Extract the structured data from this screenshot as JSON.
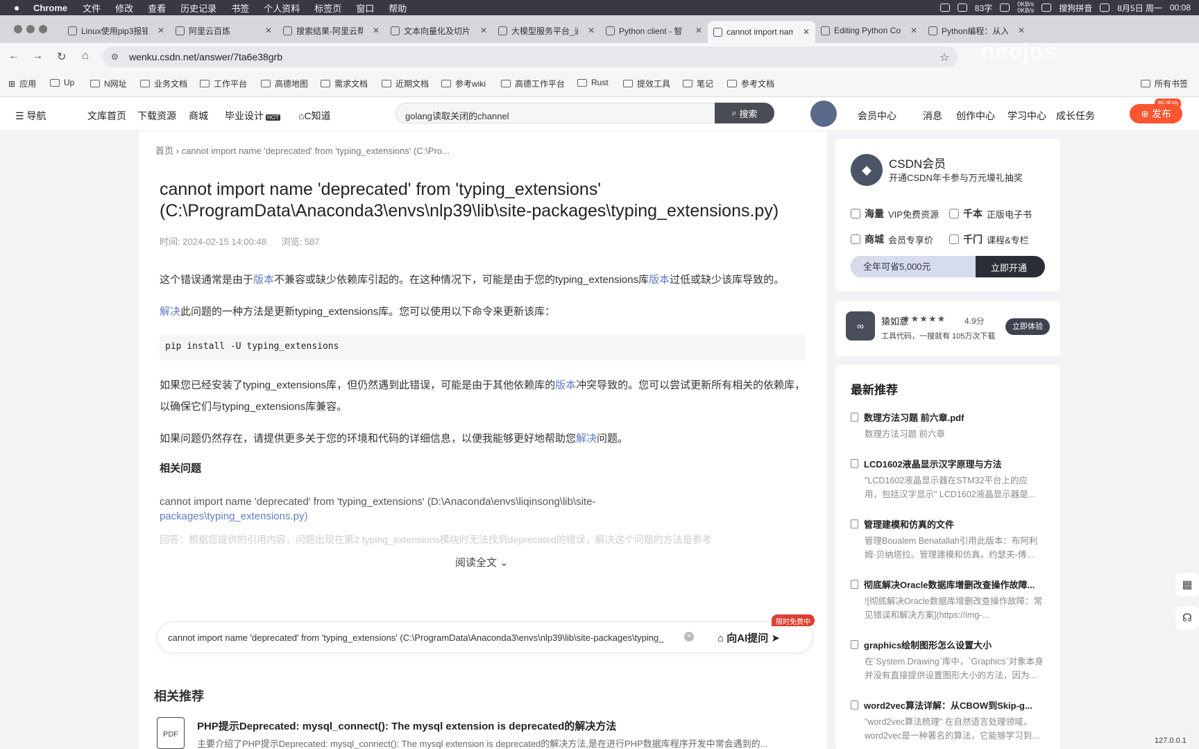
{
  "menubar": {
    "app": "Chrome",
    "items": [
      "文件",
      "修改",
      "查看",
      "历史记录",
      "书签",
      "个人资料",
      "标签页",
      "窗口",
      "帮助"
    ],
    "ime_chars": "83字",
    "net_up": "0KB/s",
    "net_down": "0KB/s",
    "ime": "搜狗拼音",
    "date": "8月5日 周一",
    "time": "00:08"
  },
  "tabs": [
    {
      "title": "Linux使用pip3报错",
      "active": false
    },
    {
      "title": "阿里云百炼",
      "active": false
    },
    {
      "title": "搜索结果-阿里云帮",
      "active": false
    },
    {
      "title": "文本向量化及切片",
      "active": false
    },
    {
      "title": "大模型服务平台_通",
      "active": false
    },
    {
      "title": "Python client - 智",
      "active": false
    },
    {
      "title": "cannot import nam",
      "active": true
    },
    {
      "title": "Editing Python Co",
      "active": false
    },
    {
      "title": "Python编程：从入",
      "active": false
    }
  ],
  "toolbar": {
    "url": "wenku.csdn.net/answer/7ta6e38grb"
  },
  "bookmarks": [
    "应用",
    "Up",
    "N网址",
    "业务文档",
    "工作平台",
    "高德地图",
    "需求文档",
    "近期文档",
    "参考wiki",
    "高德工作平台",
    "Rust",
    "提效工具",
    "笔记",
    "参考文档"
  ],
  "bookmarks_all": "所有书签",
  "site": {
    "nav": "导航",
    "links": [
      "文库首页",
      "下载资源",
      "商城",
      "毕业设计",
      "C知道"
    ],
    "hot_badge": "HOT",
    "search_value": "golang读取关闭的channel",
    "search_button": "搜索",
    "user_links": [
      "会员中心",
      "消息",
      "创作中心",
      "学习中心",
      "成长任务"
    ],
    "new_badge": "新活动",
    "publish": "发布"
  },
  "article": {
    "breadcrumb_home": "首页",
    "breadcrumb_current": "cannot import name 'deprecated' from 'typing_extensions' (C:\\Pro...",
    "title": "cannot import name 'deprecated' from 'typing_extensions' (C:\\ProgramData\\Anaconda3\\envs\\nlp39\\lib\\site-packages\\typing_extensions.py)",
    "time": "时间: 2024-02-15 14:00:48",
    "views": "浏览: 587",
    "p1": [
      "这个错误通常是由于",
      "版本",
      "不兼容或缺少依赖库引起的。在这种情况下，可能是由于您的typing_extensions库",
      "版本",
      "过低或缺少该库导致的。"
    ],
    "p2": [
      "解决",
      "此问题的一种方法是更新typing_extensions库。您可以使用以下命令来更新该库："
    ],
    "code": "pip install -U typing_extensions",
    "p3": [
      "如果您已经安装了typing_extensions库，但仍然遇到此错误，可能是由于其他依赖库的",
      "版本",
      "冲突导致的。您可以尝试更新所有相关的依赖库，以确保它们与typing_extensions库兼容。"
    ],
    "p4": [
      "如果问题仍然存在，请提供更多关于您的环境和代码的详细信息，以便我能够更好地帮助您",
      "解决",
      "问题。"
    ],
    "related_title": "相关问题",
    "related_q": "cannot import name 'deprecated' from 'typing_extensions' (D:\\Anaconda\\envs\\liqinsong\\lib\\site-",
    "related_q2": "packages\\typing_extensions.py)",
    "related_faded": "回答：根据您提供的引用内容，问题出现在第2 typing_extensions模块时无法找到deprecated的错误，解决这个问题的方法是参考",
    "read_all": "阅读全文"
  },
  "ai": {
    "input": "cannot import name 'deprecated' from 'typing_extensions' (C:\\ProgramData\\Anaconda3\\envs\\nlp39\\lib\\site-packages\\typing_",
    "ask": "向AI提问",
    "badge": "限时免费中"
  },
  "recommend": {
    "header": "相关推荐",
    "item_title": "PHP提示Deprecated: mysql_connect(): The mysql extension is deprecated的解决方法",
    "item_desc": "主要介绍了PHP提示Deprecated: mysql_connect(): The mysql extension is deprecated的解决方法,是在进行PHP数据库程序开发中常会遇到的...",
    "pdf": "PDF"
  },
  "vip": {
    "title": "CSDN会员",
    "subtitle": "开通CSDN年卡参与万元壕礼抽奖",
    "f1b": "海量",
    "f1": "VIP免费资源",
    "f2b": "千本",
    "f2": "正版电子书",
    "f3b": "商城",
    "f3": "会员专享价",
    "f4b": "千门",
    "f4": "课程&专栏",
    "save": "全年可省5,000元",
    "open": "立即开通"
  },
  "yuanruyi": {
    "name": "猿如意",
    "stars": "★★★★★",
    "score": "4.9分",
    "desc": "工具代码，一搜就有 105万次下载",
    "button": "立即体验"
  },
  "latest": {
    "header": "最新推荐",
    "items": [
      {
        "title": "数理方法习题 前六章.pdf",
        "desc": "数理方法习题 前六章"
      },
      {
        "title": "LCD1602液晶显示汉字原理与方法",
        "desc": "\"LCD1602液晶显示器在STM32平台上的应用，包括汉字显示\" LCD1602液晶显示器是..."
      },
      {
        "title": "管理建模和仿真的文件",
        "desc": "管理Boualem Benatallah引用此版本：布阿利姆·贝纳塔拉。管理建模和仿真。约瑟夫-傅..."
      },
      {
        "title": "彻底解决Oracle数据库增删改查操作故障...",
        "desc": "![彻底解决Oracle数据库增删改查操作故障：常见错误和解决方案](https://img-..."
      },
      {
        "title": "graphics绘制图形怎么设置大小",
        "desc": "在`System.Drawing`库中，`Graphics`对象本身并没有直接提供设置图形大小的方法，因为..."
      },
      {
        "title": "word2vec算法详解：从CBOW到Skip-g...",
        "desc": "\"word2vec算法梳理\" 在自然语言处理领域，word2vec是一种著名的算法，它能够学习到..."
      }
    ]
  },
  "watermark": "neojos",
  "ip": "127.0.0.1"
}
